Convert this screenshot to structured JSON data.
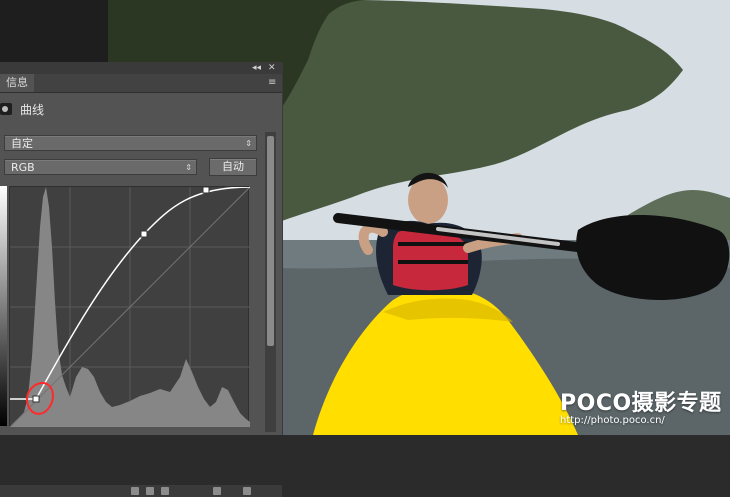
{
  "panel": {
    "tab_label": "信息",
    "title": "曲线",
    "preset_value": "自定",
    "channel_value": "RGB",
    "auto_button": "自动",
    "top_controls": [
      "◂◂",
      "✕"
    ]
  },
  "watermark": {
    "title": "POCO摄影专题",
    "url": "http://photo.poco.cn/"
  },
  "colors": {
    "panel_bg": "#535353",
    "graph_bg": "#404040",
    "curve": "#ffffff",
    "annotation": "#ff2a2a",
    "kayak": "#ffde00",
    "paddle_blade": "#111111"
  },
  "icons": {
    "menu": "panel-menu-icon",
    "title": "curves-adjustment-icon",
    "select_arrow": "up-down-arrow-icon"
  }
}
